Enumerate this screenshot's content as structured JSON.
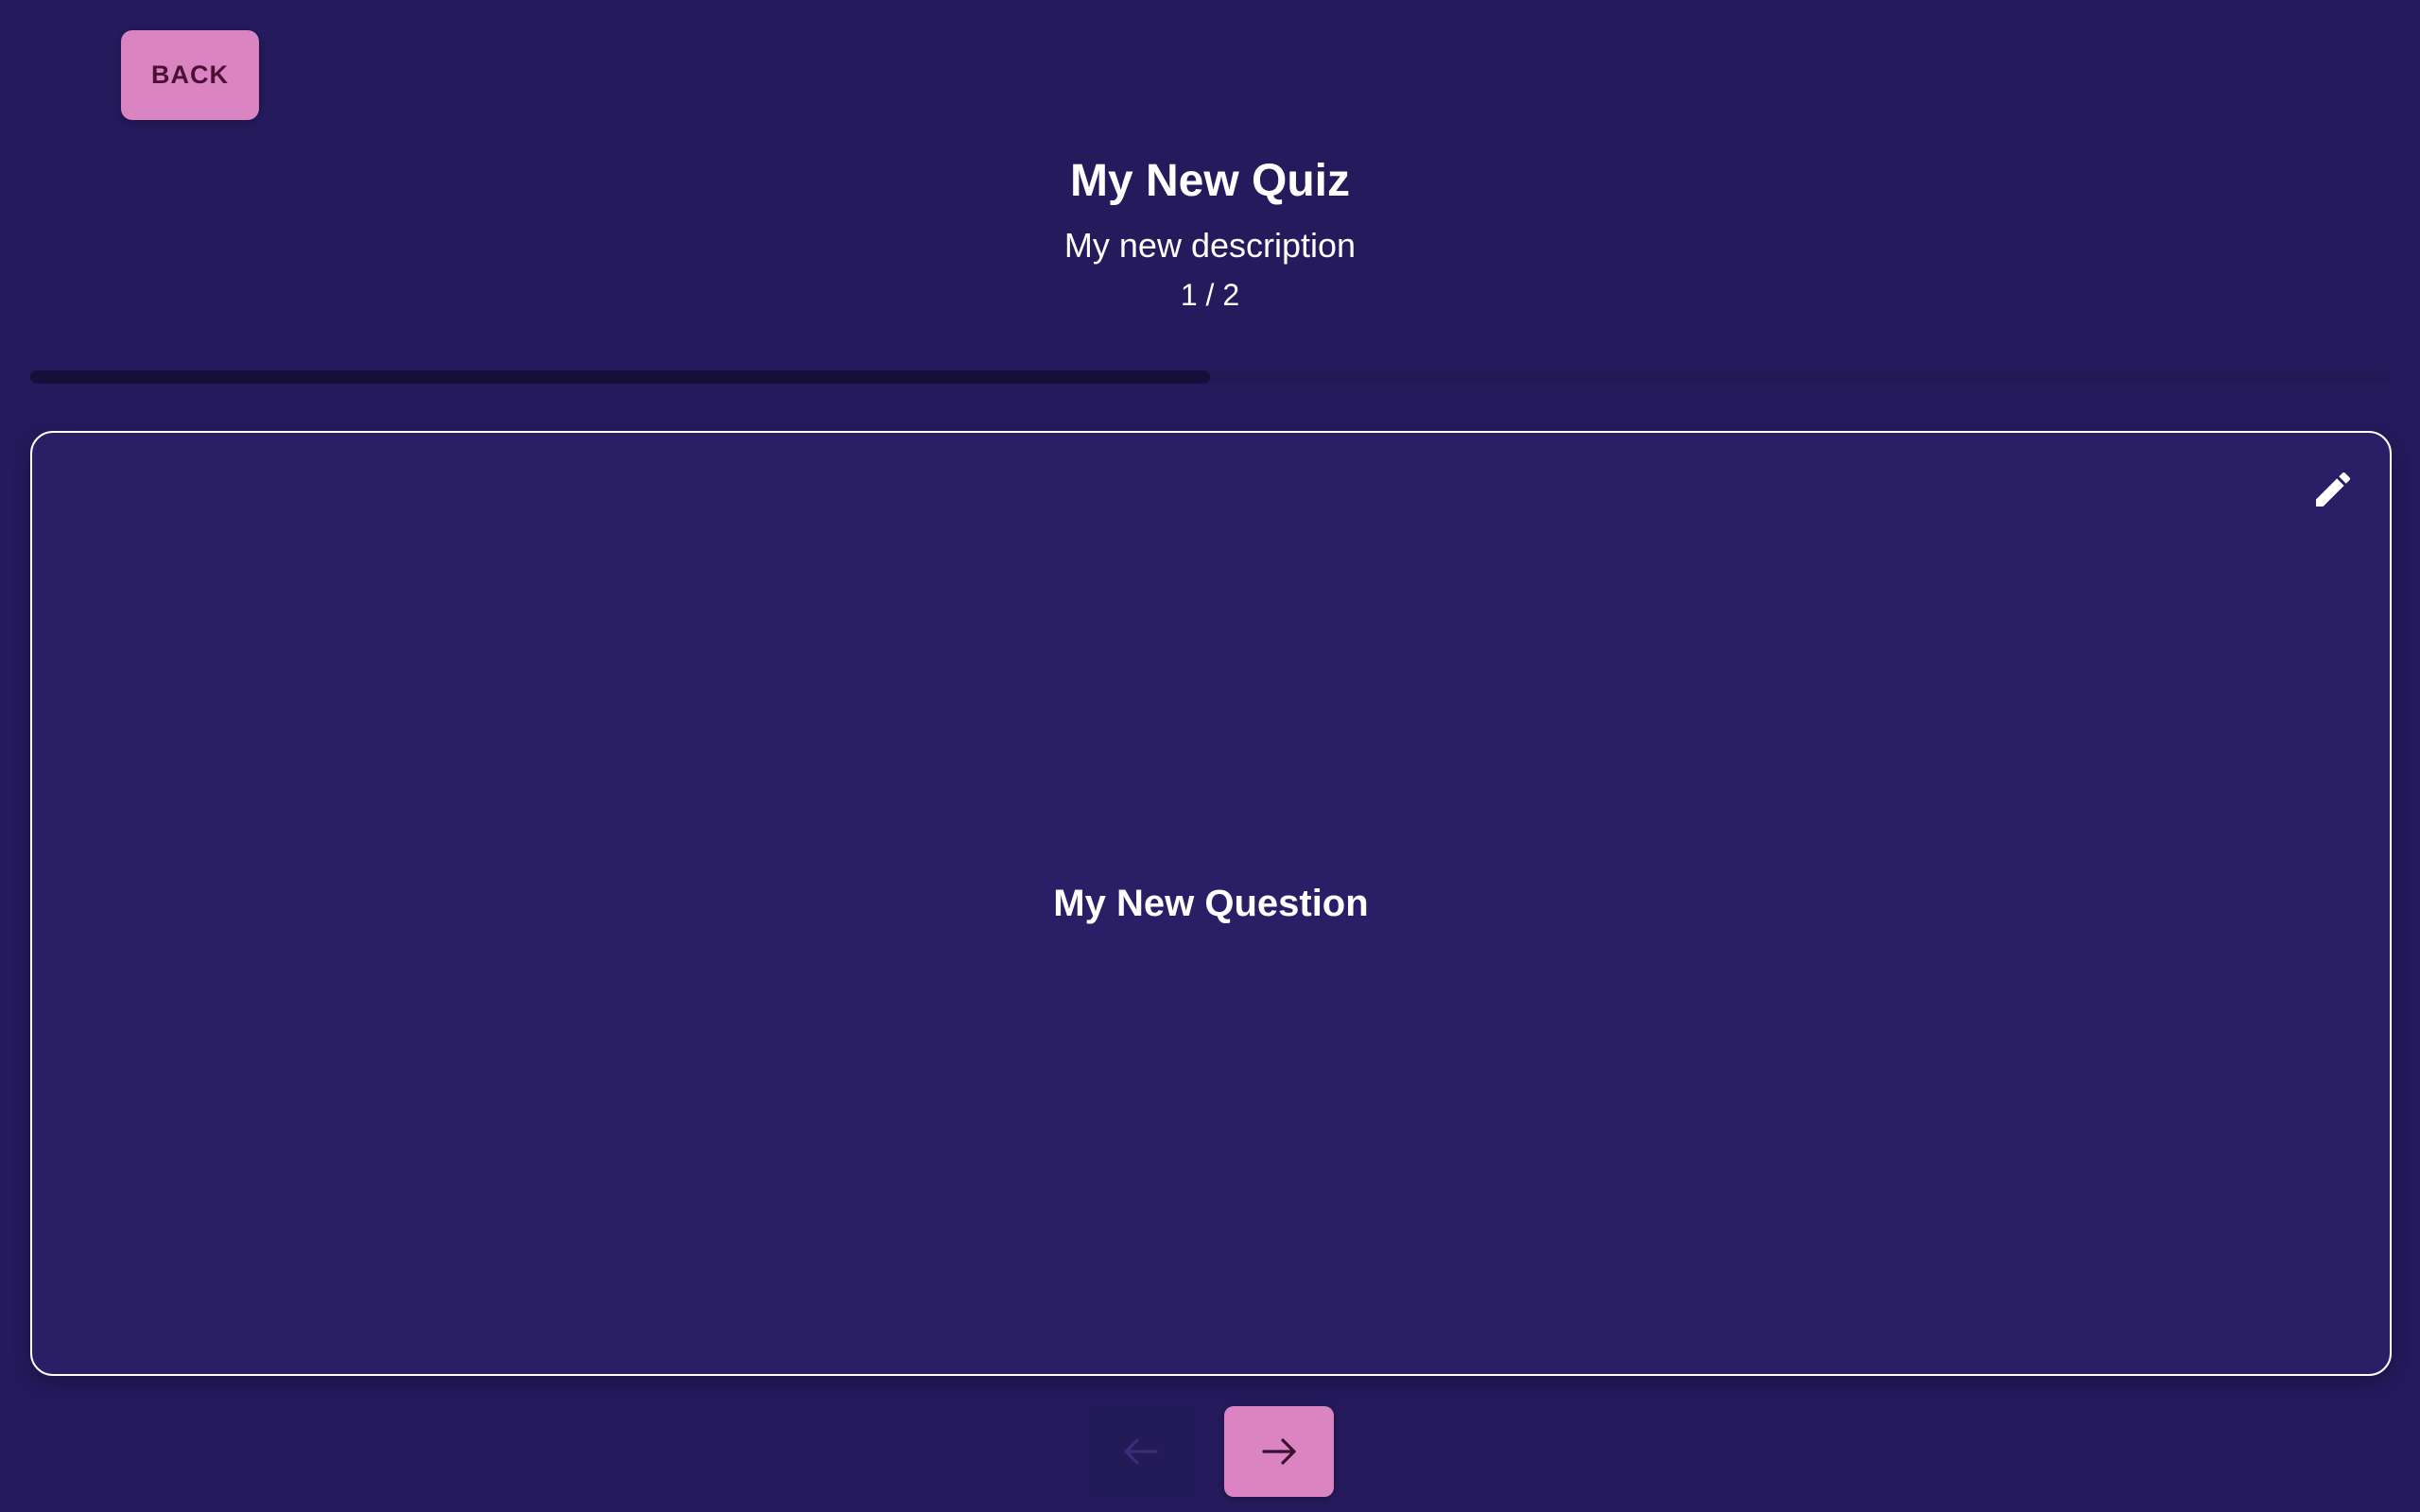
{
  "back_button": {
    "label": "BACK"
  },
  "quiz": {
    "title": "My New Quiz",
    "description": "My new description",
    "page_counter": "1 / 2",
    "progress_fraction": 0.5
  },
  "question": {
    "text": "My New Question"
  },
  "icons": {
    "edit": "pencil-icon",
    "prev": "arrow-left-icon",
    "next": "arrow-right-icon"
  },
  "colors": {
    "background": "#241a5c",
    "card": "#2a1e66",
    "accent": "#db84c2",
    "accent_text": "#4a1036",
    "progress_fill": "#160f3a"
  },
  "navigation": {
    "prev_disabled": true,
    "next_disabled": false
  }
}
